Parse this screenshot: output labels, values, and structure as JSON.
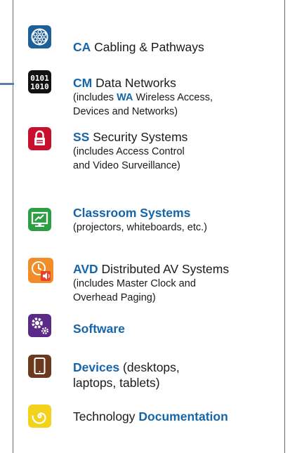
{
  "colors": {
    "accent": "#1565a8",
    "ca_icon": "#1d5f98",
    "cm_icon": "#111111",
    "ss_icon": "#c8102e",
    "classroom_icon": "#2e9e44",
    "avd_icon": "#f28c28",
    "software_icon": "#5b2a86",
    "devices_icon": "#6b3a1e",
    "docs_icon": "#f2d21b"
  },
  "items": [
    {
      "icon": "cable-reel-icon",
      "code": "CA",
      "title": "Cabling & Pathways",
      "sub1": "",
      "sub2": ""
    },
    {
      "icon": "binary-data-icon",
      "code": "CM",
      "title": "Data Networks",
      "sub_pre": "(includes ",
      "sub_code": "WA",
      "sub_post": " Wireless Access,",
      "sub2": "Devices and Networks)"
    },
    {
      "icon": "padlock-icon",
      "code": "SS",
      "title": "Security Systems",
      "sub1": "(includes Access Control",
      "sub2": "and Video Surveillance)"
    },
    {
      "icon": "monitor-icon",
      "code": "Classroom Systems",
      "title": "",
      "sub1": "(projectors, whiteboards, etc.)"
    },
    {
      "icon": "clock-speaker-icon",
      "code": "AVD",
      "title": "Distributed AV Systems",
      "sub1": "(includes Master Clock and",
      "sub2": "Overhead Paging)"
    },
    {
      "icon": "gears-icon",
      "code": "Software"
    },
    {
      "icon": "tablet-icon",
      "code": "Devices",
      "title": "(desktops,",
      "sub1": "laptops, tablets)"
    },
    {
      "icon": "spiral-icon",
      "pre": "Technology ",
      "code": "Documentation"
    }
  ]
}
